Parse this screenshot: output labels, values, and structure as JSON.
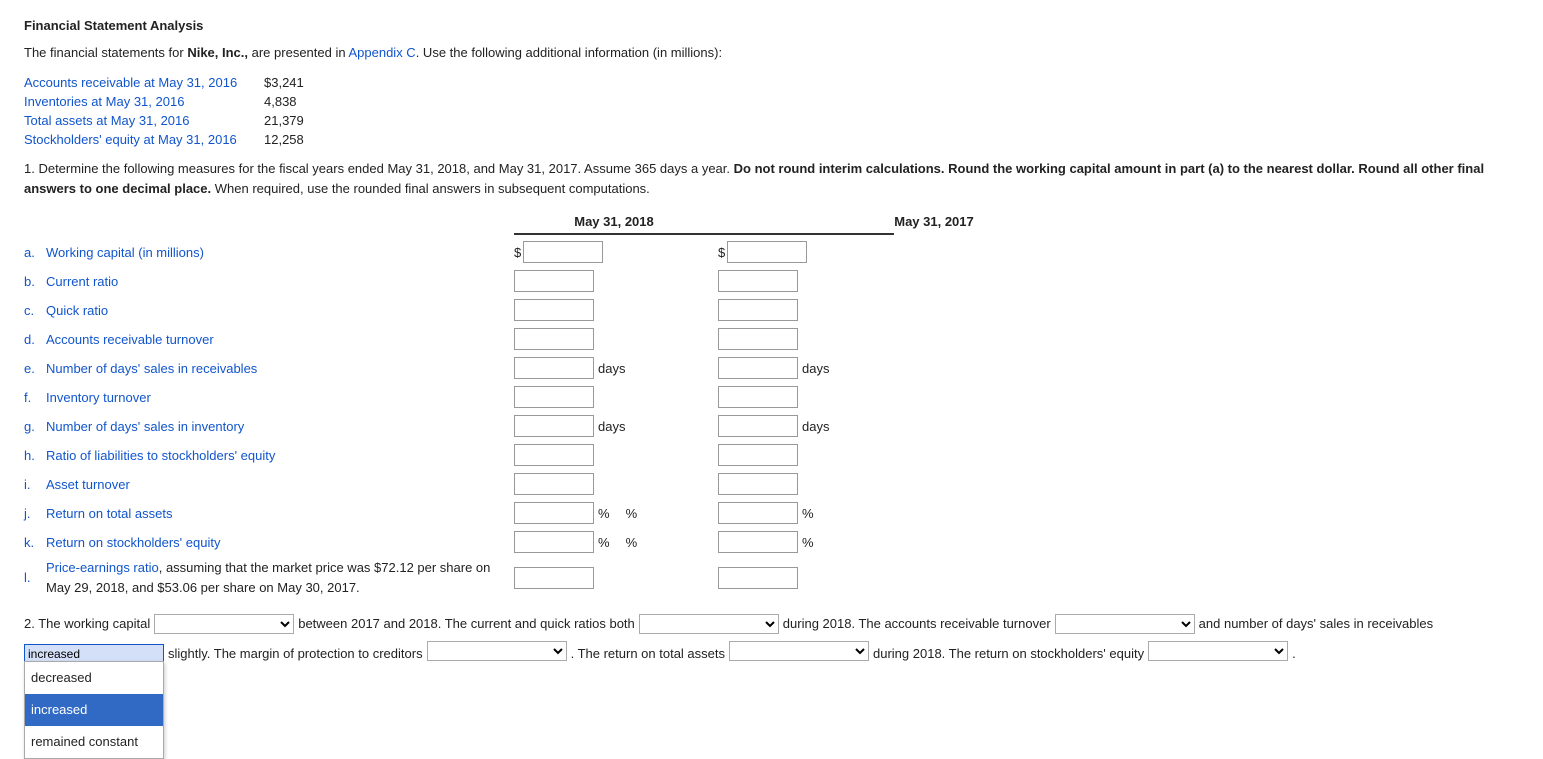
{
  "page": {
    "title": "Financial Statement Analysis",
    "intro": {
      "text_start": "The financial statements for ",
      "company": "Nike, Inc.,",
      "text_mid": " are presented in ",
      "appendix_link": "Appendix C",
      "text_end": ". Use the following additional information (in millions):"
    },
    "info_rows": [
      {
        "label": "Accounts receivable at May 31, 2016",
        "value": "$3,241"
      },
      {
        "label": "Inventories at May 31, 2016",
        "value": "4,838"
      },
      {
        "label": "Total assets at May 31, 2016",
        "value": "21,379"
      },
      {
        "label": "Stockholders' equity at May 31, 2016",
        "value": "12,258"
      }
    ],
    "instructions": "1. Determine the following measures for the fiscal years ended May 31, 2018, and May 31, 2017. Assume 365 days a year. Do not round interim calculations. Round the working capital amount in part (a) to the nearest dollar. Round all other final answers to one decimal place. When required, use the rounded final answers in subsequent computations.",
    "col_2018": "May 31, 2018",
    "col_2017": "May 31, 2017",
    "measures": [
      {
        "letter": "a.",
        "label": "Working capital (in millions)",
        "label_plain": "",
        "has_dollar_2018": true,
        "has_dollar_2017": true,
        "unit_2018": "",
        "unit_2017": ""
      },
      {
        "letter": "b.",
        "label": "Current ratio",
        "label_plain": "",
        "has_dollar_2018": false,
        "has_dollar_2017": false,
        "unit_2018": "",
        "unit_2017": ""
      },
      {
        "letter": "c.",
        "label": "Quick ratio",
        "label_plain": "",
        "has_dollar_2018": false,
        "has_dollar_2017": false,
        "unit_2018": "",
        "unit_2017": ""
      },
      {
        "letter": "d.",
        "label": "Accounts receivable turnover",
        "label_plain": "",
        "has_dollar_2018": false,
        "has_dollar_2017": false,
        "unit_2018": "",
        "unit_2017": ""
      },
      {
        "letter": "e.",
        "label": "Number of days' sales in receivables",
        "label_plain": "",
        "has_dollar_2018": false,
        "has_dollar_2017": false,
        "unit_2018": "days",
        "unit_2017": "days"
      },
      {
        "letter": "f.",
        "label": "Inventory turnover",
        "label_plain": "",
        "has_dollar_2018": false,
        "has_dollar_2017": false,
        "unit_2018": "",
        "unit_2017": ""
      },
      {
        "letter": "g.",
        "label": "Number of days' sales in inventory",
        "label_plain": "",
        "has_dollar_2018": false,
        "has_dollar_2017": false,
        "unit_2018": "days",
        "unit_2017": "days"
      },
      {
        "letter": "h.",
        "label": "Ratio of liabilities to stockholders' equity",
        "label_plain": "",
        "has_dollar_2018": false,
        "has_dollar_2017": false,
        "unit_2018": "",
        "unit_2017": ""
      },
      {
        "letter": "i.",
        "label": "Asset turnover",
        "label_plain": "",
        "has_dollar_2018": false,
        "has_dollar_2017": false,
        "unit_2018": "",
        "unit_2017": ""
      },
      {
        "letter": "j.",
        "label": "Return on total assets",
        "label_plain": "",
        "has_dollar_2018": false,
        "has_dollar_2017": false,
        "unit_2018": "%",
        "unit_2017": "%"
      },
      {
        "letter": "k.",
        "label": "Return on stockholders' equity",
        "label_plain": "",
        "has_dollar_2018": false,
        "has_dollar_2017": false,
        "unit_2018": "%",
        "unit_2017": "%"
      },
      {
        "letter": "l.",
        "label": "Price-earnings ratio, assuming that the market price was $72.12 per share on May 29, 2018, and $53.06 per share on May 30, 2017.",
        "label_plain": "",
        "has_dollar_2018": false,
        "has_dollar_2017": false,
        "unit_2018": "",
        "unit_2017": "",
        "multiline": true
      }
    ],
    "section2": {
      "label": "2.",
      "text1": "The working capital",
      "text2": "between 2017 and 2018. The current and quick ratios both",
      "text3": "during 2018. The accounts receivable turnover",
      "text4": "and number of days' sales in receivables",
      "text5": "slightly. The margin of protection to creditors",
      "text6": ". The return on total assets",
      "text7": "during 2018. The return on stockholders' equity",
      "text8": ".",
      "dropdown_options": [
        "",
        "decreased",
        "increased",
        "remained constant"
      ],
      "open_dropdown_items": [
        "decreased",
        "increased",
        "remained constant"
      ],
      "open_dropdown_selected": "increased"
    }
  }
}
